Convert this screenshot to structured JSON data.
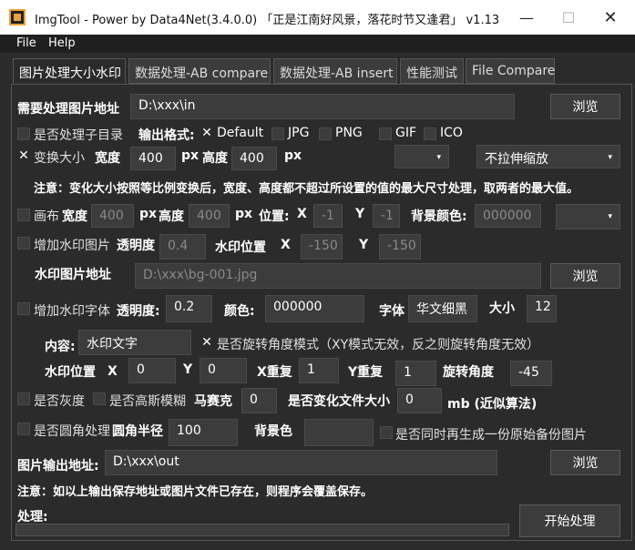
{
  "title": "ImgTool  -  Power by Data4Net(3.4.0.0)  「正是江南好风景，落花时节又逢君」 v1.13",
  "window_controls": {
    "minimize": "—",
    "maximize": "☐",
    "close": "✕"
  },
  "menu": [
    "File",
    "Help"
  ],
  "tabs": [
    "图片处理大小水印",
    "数据处理-AB compare",
    "数据处理-AB insert",
    "性能测试",
    "File Compare"
  ],
  "input_path": {
    "label": "需要处理图片地址",
    "value": "D:\\xxx\\in",
    "browse": "浏览"
  },
  "subdir": {
    "label": "是否处理子目录"
  },
  "output_format": {
    "label": "输出格式:",
    "options": [
      "Default",
      "JPG",
      "PNG",
      "GIF",
      "ICO"
    ],
    "selected": "Default"
  },
  "resize": {
    "label": "变换大小",
    "checked": true,
    "width_label": "宽度",
    "width": "400",
    "px1": "px",
    "height_label": "高度",
    "height": "400",
    "px2": "px",
    "combo1": "",
    "combo2": "不拉伸缩放"
  },
  "note1": "注意：变化大小按照等比例变换后，宽度、高度都不超过所设置的值的最大尺寸处理，取两者的最大值。",
  "canvas": {
    "label": "画布",
    "width_label": "宽度",
    "width": "400",
    "px1": "px",
    "height_label": "高度",
    "height": "400",
    "px2": "px",
    "pos_label": "位置:",
    "x_label": "X",
    "x": "-1",
    "y_label": "Y",
    "y": "-1",
    "bg_label": "背景颜色:",
    "bg": "000000",
    "combo": ""
  },
  "wm_image": {
    "label": "增加水印图片",
    "opacity_label": "透明度",
    "opacity": "0.4",
    "pos_label": "水印位置",
    "x_label": "X",
    "x": "-150",
    "y_label": "Y",
    "y": "-150",
    "path_label": "水印图片地址",
    "path": "D:\\xxx\\bg-001.jpg",
    "browse": "浏览"
  },
  "wm_text": {
    "label": "增加水印字体",
    "opacity_label": "透明度:",
    "opacity": "0.2",
    "color_label": "颜色:",
    "color": "000000",
    "font_label": "字体",
    "font": "华文细黑",
    "size_label": "大小",
    "size": "12",
    "content_label": "内容:",
    "content": "水印文字",
    "rotate_label": "是否旋转角度模式（XY模式无效，反之则旋转角度无效）",
    "rotate_checked": true,
    "pos_label": "水印位置",
    "x_label": "X",
    "x": "0",
    "y_label": "Y",
    "y": "0",
    "xrepeat_label": "X重复",
    "xrepeat": "1",
    "yrepeat_label": "Y重复",
    "yrepeat": "1",
    "angle_label": "旋转角度",
    "angle": "-45"
  },
  "grayscale": {
    "label": "是否灰度"
  },
  "gauss": {
    "label": "是否高斯模糊",
    "mosaic_label": "马赛克",
    "mosaic": "0"
  },
  "filesize": {
    "label": "是否变化文件大小",
    "value": "0",
    "unit": "mb (近似算法)"
  },
  "round": {
    "label": "是否圆角处理",
    "radius_label": "圆角半径",
    "radius": "100",
    "bg_label": "背景色",
    "bg": ""
  },
  "backup": {
    "label": "是否同时再生成一份原始备份图片"
  },
  "output_path": {
    "label": "图片输出地址:",
    "value": "D:\\xxx\\out",
    "browse": "浏览"
  },
  "note2": "注意：如以上输出保存地址或图片文件已存在，则程序会覆盖保存。",
  "process": {
    "label": "处理:",
    "progress": 0,
    "start": "开始处理"
  }
}
